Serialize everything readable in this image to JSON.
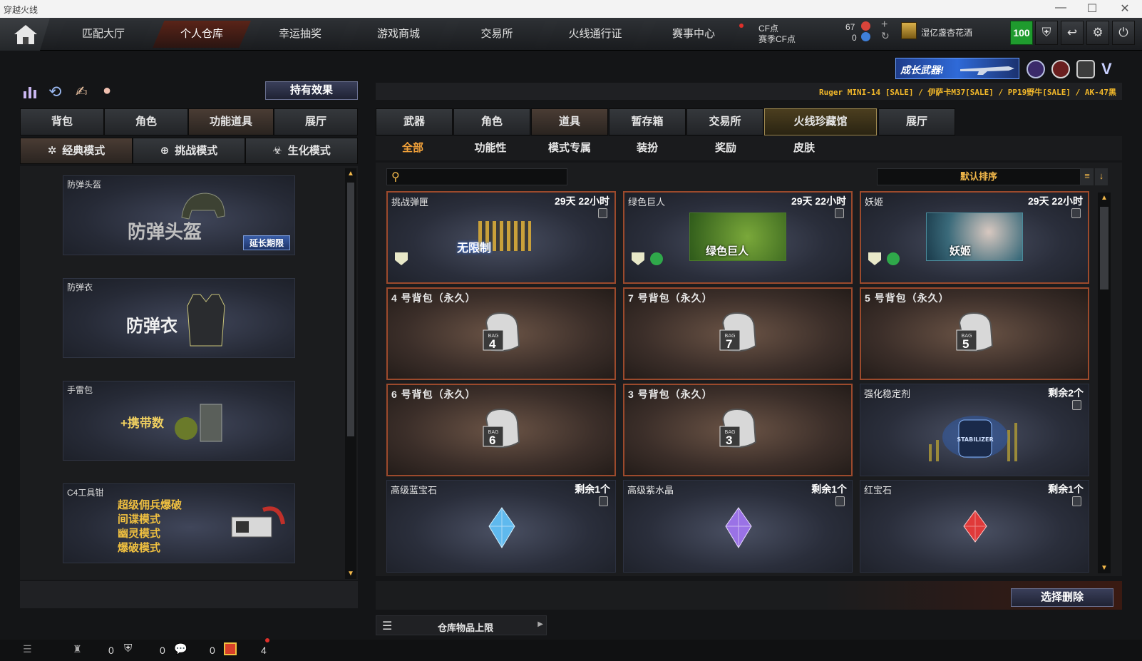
{
  "window": {
    "title": "穿越火线",
    "controls": {
      "minimize": "—",
      "maximize": "☐",
      "close": "✕"
    }
  },
  "nav": {
    "tabs": [
      "匹配大厅",
      "个人仓库",
      "幸运抽奖",
      "游戏商城",
      "交易所",
      "火线通行证",
      "赛事中心"
    ],
    "active_tab": "个人仓库",
    "cf_label": "CF点",
    "cf_value": "67",
    "season_cf_label": "赛季CF点",
    "season_cf_value": "0",
    "username": "湿亿盏杏花酒",
    "level": "100"
  },
  "banner": {
    "text": "成长武器!"
  },
  "ticker": "Ruger MINI-14  [SALE] / 伊萨卡M37[SALE] / PP19野牛[SALE] / AK-47黑",
  "left": {
    "effects_button": "持有效果",
    "tabs": [
      "背包",
      "角色",
      "功能道具",
      "展厅"
    ],
    "active_tab": "功能道具",
    "modes": [
      "经典模式",
      "挑战模式",
      "生化模式"
    ],
    "active_mode": "经典模式",
    "items": [
      {
        "name": "防弹头盔",
        "art": "防弹头盔",
        "badge": "延长期限"
      },
      {
        "name": "防弹衣",
        "art": "防弹衣"
      },
      {
        "name": "手雷包",
        "art": "+携带数"
      },
      {
        "name": "C4工具钳",
        "art_lines": [
          "超级佣兵爆破",
          "间谍模式",
          "幽灵模式",
          "爆破模式"
        ]
      }
    ]
  },
  "right": {
    "tabs": [
      "武器",
      "角色",
      "道具",
      "暂存箱",
      "交易所",
      "火线珍藏馆",
      "展厅"
    ],
    "active_tab": "道具",
    "highlight_tab": "火线珍藏馆",
    "subtabs": [
      "全部",
      "功能性",
      "模式专属",
      "装扮",
      "奖励",
      "皮肤"
    ],
    "active_subtab": "全部",
    "search_placeholder": "",
    "sort_label": "默认排序",
    "items": [
      {
        "name": "挑战弹匣",
        "time": "29天 22小时",
        "art": "无限制",
        "type": "ammo"
      },
      {
        "name": "绿色巨人",
        "time": "29天 22小时",
        "art": "绿色巨人",
        "type": "zombie"
      },
      {
        "name": "妖姬",
        "time": "29天 22小时",
        "art": "妖姬",
        "type": "witch"
      },
      {
        "name": "4 号背包（永久）",
        "bag": "4",
        "type": "bag"
      },
      {
        "name": "7 号背包（永久）",
        "bag": "7",
        "type": "bag"
      },
      {
        "name": "5 号背包（永久）",
        "bag": "5",
        "type": "bag"
      },
      {
        "name": "6 号背包（永久）",
        "bag": "6",
        "type": "bag"
      },
      {
        "name": "3 号背包（永久）",
        "bag": "3",
        "type": "bag"
      },
      {
        "name": "强化稳定剂",
        "time": "剩余2个",
        "art": "STABILIZER",
        "type": "stabilizer"
      },
      {
        "name": "高级蓝宝石",
        "time": "剩余1个",
        "type": "gem",
        "color": "#5fb9ee"
      },
      {
        "name": "高级紫水晶",
        "time": "剩余1个",
        "type": "gem",
        "color": "#9a72e6"
      },
      {
        "name": "红宝石",
        "time": "剩余1个",
        "type": "gem",
        "color": "#e03a3a"
      }
    ],
    "delete_button": "选择删除",
    "capacity_label": "仓库物品上限"
  },
  "status": {
    "count1": "0",
    "count2": "0",
    "count3": "0",
    "count4": "4"
  },
  "colors": {
    "accent": "#f2a23a",
    "bag_border": "#9c4a2c",
    "level_green": "#1f9b2e"
  }
}
